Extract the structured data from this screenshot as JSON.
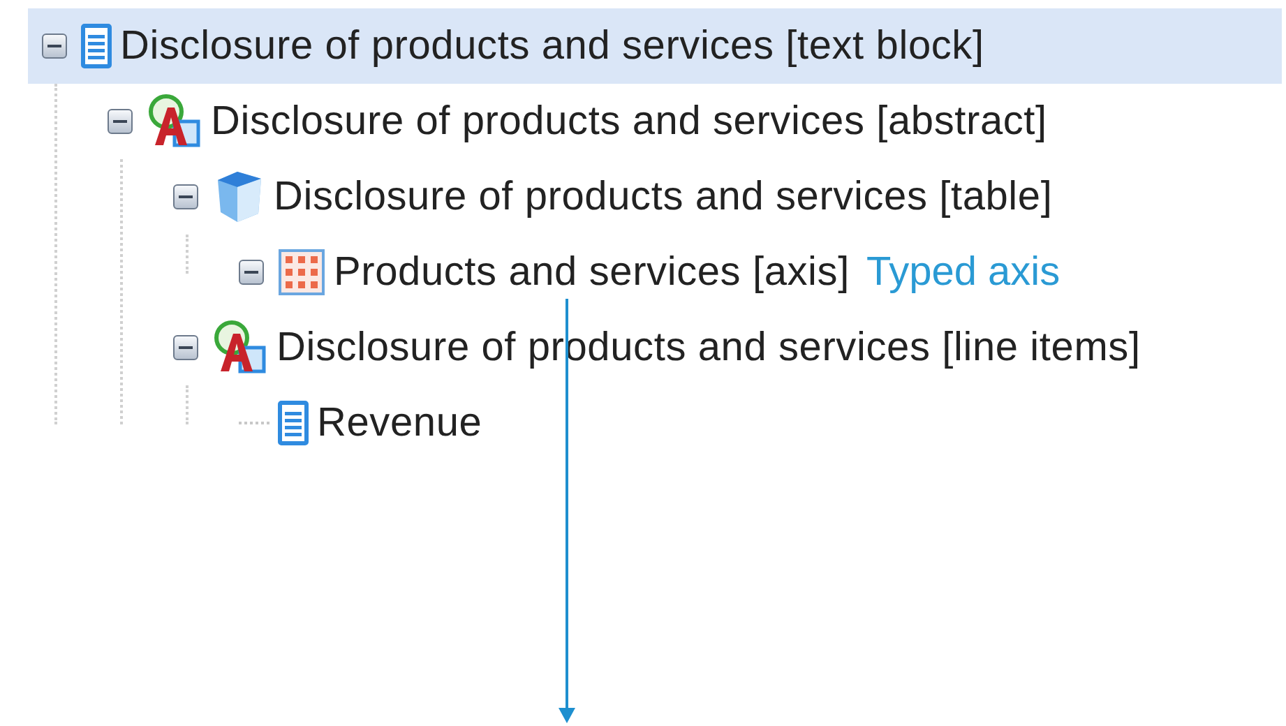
{
  "tree": [
    {
      "label": "Disclosure of products and services [text block]",
      "kind": "document",
      "expanded": true,
      "selected": true,
      "children": [
        {
          "label": "Disclosure of products and services [abstract]",
          "kind": "abstract",
          "expanded": true,
          "selected": false,
          "children": [
            {
              "label": "Disclosure of products and services [table]",
              "kind": "table",
              "expanded": true,
              "selected": false,
              "children": [
                {
                  "label": "Products and services [axis]",
                  "kind": "axis",
                  "expanded": true,
                  "selected": false,
                  "note": "Typed axis"
                }
              ]
            },
            {
              "label": "Disclosure of products and services [line items]",
              "kind": "abstract",
              "expanded": true,
              "selected": false,
              "children": [
                {
                  "label": "Revenue",
                  "kind": "document",
                  "selected": false
                }
              ]
            }
          ]
        }
      ]
    }
  ]
}
